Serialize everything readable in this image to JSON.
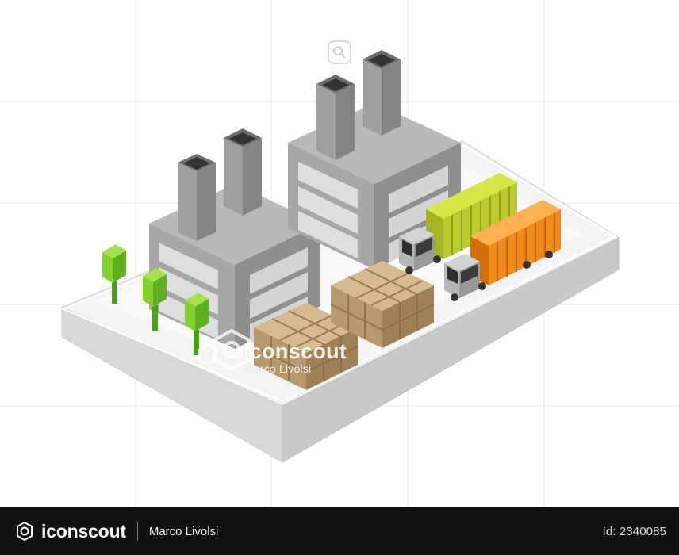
{
  "watermark": {
    "brand": "iconscout",
    "author": "Marco Livolsi"
  },
  "footer": {
    "brand": "iconscout",
    "author": "Marco Livolsi",
    "id_label": "Id: 2340085"
  },
  "colors": {
    "footer_background": "#111114",
    "grid_line": "#e9e9e9",
    "platform_top": "#f3f3f3",
    "platform_side": "#dcdcdc",
    "building_gray": "#a7a7a7",
    "tree_green": "#83d12b",
    "trunk_green": "#4b9d1e",
    "box_tan": "#c6aa80",
    "truck_container_yellow": "#bacb2d",
    "truck_container_orange": "#f08a1a"
  },
  "icons": {
    "watermark_logo": "iconscout-logo",
    "footer_logo": "iconscout-logo",
    "top_watermark_icon": "iconscout-badge"
  }
}
